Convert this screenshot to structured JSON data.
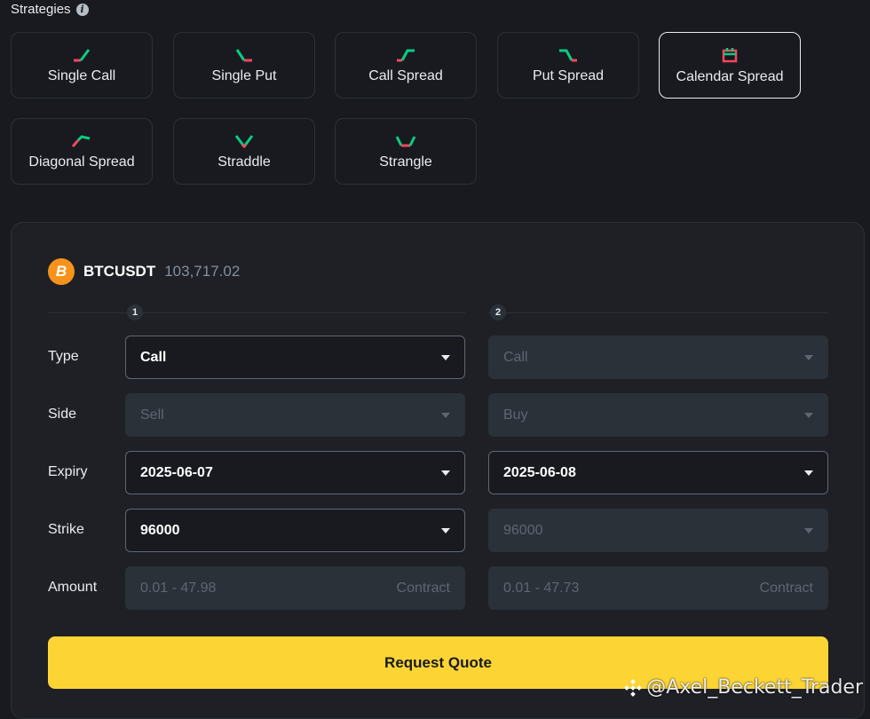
{
  "header": {
    "title": "Strategies",
    "info_icon": "info-icon"
  },
  "strategies": [
    {
      "label": "Single Call",
      "icon": "single-call-icon",
      "active": false
    },
    {
      "label": "Single Put",
      "icon": "single-put-icon",
      "active": false
    },
    {
      "label": "Call Spread",
      "icon": "call-spread-icon",
      "active": false
    },
    {
      "label": "Put Spread",
      "icon": "put-spread-icon",
      "active": false
    },
    {
      "label": "Calendar Spread",
      "icon": "calendar-spread-icon",
      "active": true
    },
    {
      "label": "Diagonal Spread",
      "icon": "diagonal-spread-icon",
      "active": false
    },
    {
      "label": "Straddle",
      "icon": "straddle-icon",
      "active": false
    },
    {
      "label": "Strangle",
      "icon": "strangle-icon",
      "active": false
    }
  ],
  "symbol": {
    "icon_letter": "B",
    "name": "BTCUSDT",
    "price": "103,717.02"
  },
  "legs": [
    "1",
    "2"
  ],
  "form": {
    "labels": {
      "type": "Type",
      "side": "Side",
      "expiry": "Expiry",
      "strike": "Strike",
      "amount": "Amount"
    },
    "leg1": {
      "type": "Call",
      "side": "Sell",
      "expiry": "2025-06-07",
      "strike": "96000",
      "amount_placeholder": "0.01 - 47.98",
      "amount_unit": "Contract"
    },
    "leg2": {
      "type": "Call",
      "side": "Buy",
      "expiry": "2025-06-08",
      "strike": "96000",
      "amount_placeholder": "0.01 - 47.73",
      "amount_unit": "Contract"
    }
  },
  "actions": {
    "request_quote": "Request Quote"
  },
  "watermark": "@Axel_Beckett_Trader",
  "colors": {
    "accent": "#fcd535",
    "up": "#0ecb81",
    "down": "#f6465d"
  }
}
